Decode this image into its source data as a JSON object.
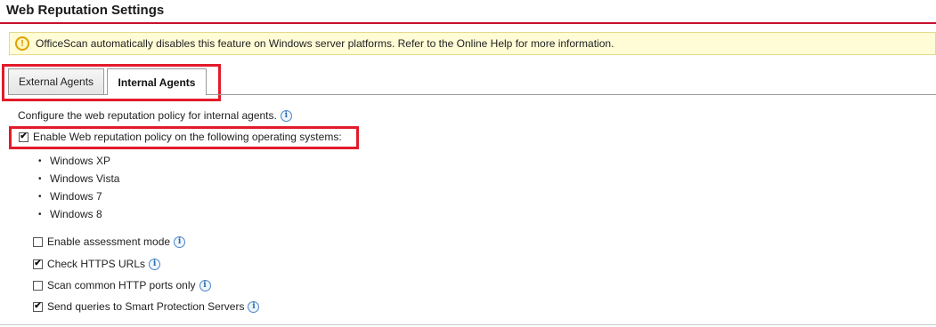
{
  "page": {
    "title": "Web Reputation Settings"
  },
  "notice": {
    "icon": "warning-icon",
    "text": "OfficeScan automatically disables this feature on Windows server platforms. Refer to the Online Help for more information."
  },
  "tabs": [
    {
      "label": "External Agents",
      "active": false
    },
    {
      "label": "Internal Agents",
      "active": true
    }
  ],
  "main": {
    "description": "Configure the web reputation policy for internal agents.",
    "enable_policy": {
      "label": "Enable Web reputation policy on the following operating systems:",
      "checked": true
    },
    "operating_systems": [
      "Windows XP",
      "Windows Vista",
      "Windows 7",
      "Windows 8"
    ],
    "options": [
      {
        "label": "Enable assessment mode",
        "checked": false
      },
      {
        "label": "Check HTTPS URLs",
        "checked": true
      },
      {
        "label": "Scan common HTTP ports only",
        "checked": false
      },
      {
        "label": "Send queries to Smart Protection Servers",
        "checked": true
      }
    ]
  },
  "colors": {
    "accent_red": "#c8102e",
    "highlight_red": "#e21b2b",
    "notice_bg": "#fffcd6",
    "info_blue": "#2a6ab0"
  }
}
